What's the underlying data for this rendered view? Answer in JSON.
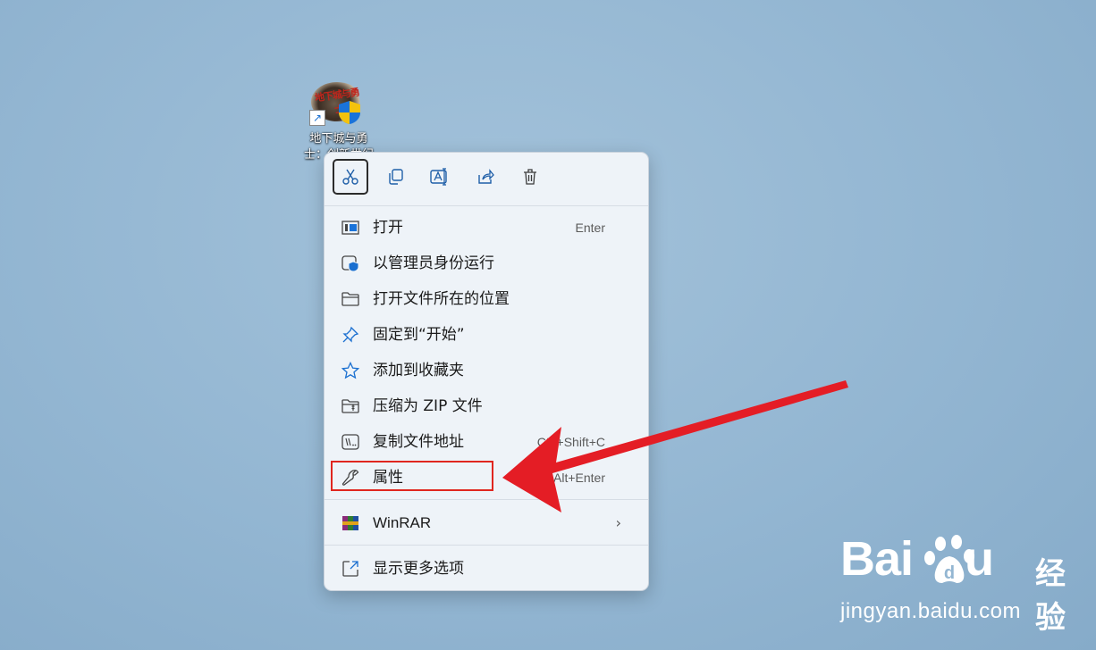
{
  "desktop": {
    "shortcut": {
      "label": "地下城与勇士：创新世纪",
      "art_text": "地下城与勇士",
      "art_sub": "创新世纪",
      "icon": "dnf-game-icon"
    }
  },
  "context_menu": {
    "toolbar": [
      {
        "name": "cut",
        "icon": "scissors-icon",
        "active": true
      },
      {
        "name": "copy",
        "icon": "copy-icon"
      },
      {
        "name": "rename",
        "icon": "rename-icon"
      },
      {
        "name": "share",
        "icon": "share-icon"
      },
      {
        "name": "delete",
        "icon": "trash-icon"
      }
    ],
    "items": [
      {
        "label": "打开",
        "shortcut": "Enter",
        "icon": "open-window-icon"
      },
      {
        "label": "以管理员身份运行",
        "shortcut": "",
        "icon": "admin-shield-icon"
      },
      {
        "label": "打开文件所在的位置",
        "shortcut": "",
        "icon": "folder-icon"
      },
      {
        "label": "固定到“开始”",
        "shortcut": "",
        "icon": "pin-icon"
      },
      {
        "label": "添加到收藏夹",
        "shortcut": "",
        "icon": "star-icon"
      },
      {
        "label": "压缩为 ZIP 文件",
        "shortcut": "",
        "icon": "zip-folder-icon"
      },
      {
        "label": "复制文件地址",
        "shortcut": "Ctrl+Shift+C",
        "icon": "copy-path-icon"
      },
      {
        "label": "属性",
        "shortcut": "Alt+Enter",
        "icon": "wrench-icon"
      }
    ],
    "winrar": {
      "label": "WinRAR",
      "icon": "winrar-icon"
    },
    "more": {
      "label": "显示更多选项",
      "icon": "more-options-icon"
    }
  },
  "annotation": {
    "color": "#e0261f"
  },
  "watermark": {
    "brand_left": "Bai",
    "brand_right": "u",
    "product": "经验",
    "url": "jingyan.baidu.com"
  }
}
